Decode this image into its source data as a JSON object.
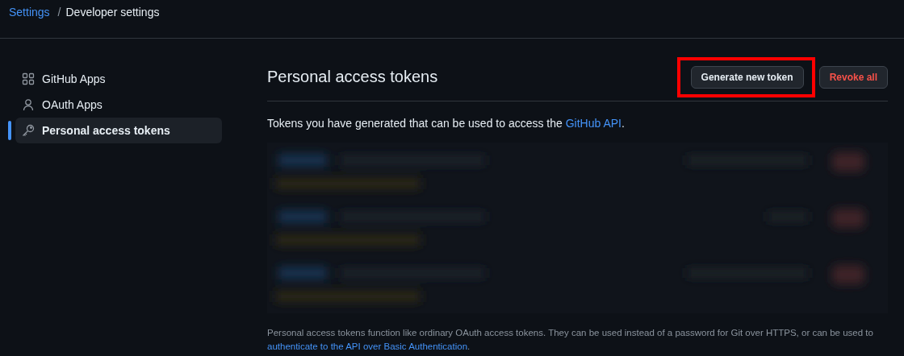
{
  "breadcrumb": [
    {
      "label": "Settings",
      "kind": "link"
    },
    {
      "label": "/",
      "kind": "separator"
    },
    {
      "label": "Developer settings",
      "kind": "current"
    }
  ],
  "sidebar": {
    "items": [
      {
        "label": "GitHub Apps",
        "kind": "apps",
        "selected": false
      },
      {
        "label": "OAuth Apps",
        "kind": "person",
        "selected": false
      },
      {
        "label": "Personal access tokens",
        "kind": "key",
        "selected": true
      }
    ]
  },
  "main": {
    "title": "Personal access tokens",
    "buttons": [
      {
        "label": "Generate new token",
        "kind": "default",
        "highlighted": true
      },
      {
        "label": "Revoke all",
        "kind": "danger",
        "highlighted": false
      }
    ],
    "description": {
      "text": "Tokens you have generated that can be used to access the ",
      "link": "GitHub API",
      "after": "."
    },
    "footer": {
      "text": "Personal access tokens function like ordinary OAuth access tokens. They can be used instead of a password for Git over HTTPS, or can be used to ",
      "link": "authenticate to the API over Basic Authentication",
      "after": "."
    }
  }
}
